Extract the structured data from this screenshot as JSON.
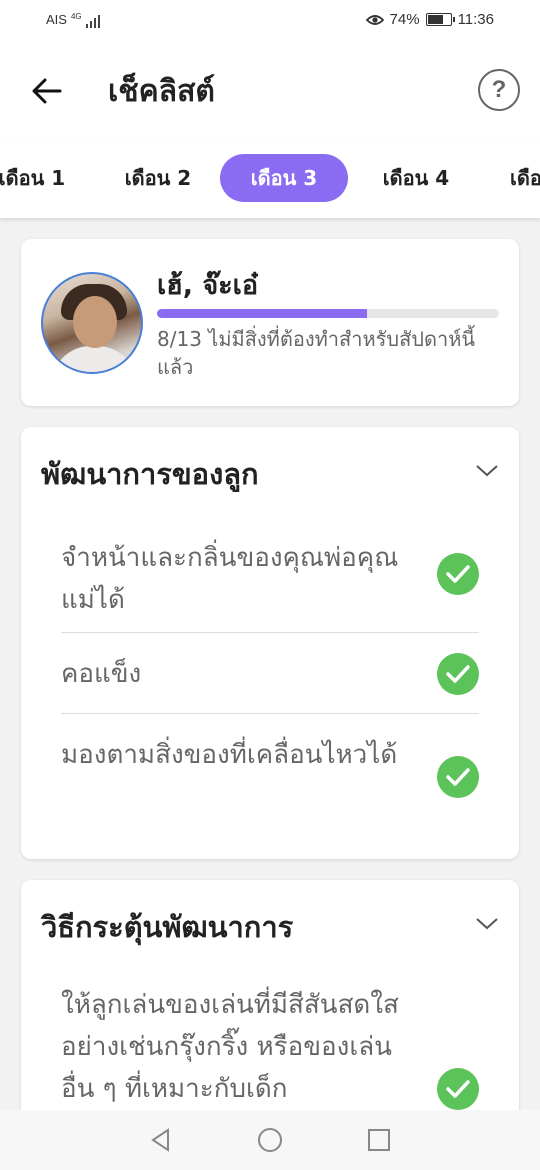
{
  "status_bar": {
    "carrier": "AIS",
    "network": "4G",
    "battery": "74%",
    "battery_level": 0.74,
    "time": "11:36"
  },
  "header": {
    "title": "เช็คลิสต์",
    "back_icon": "arrow-left-icon",
    "help_icon": "question-circle-icon",
    "help_glyph": "?"
  },
  "tabs": [
    {
      "label": "เดือน 1",
      "active": false
    },
    {
      "label": "เดือน 2",
      "active": false
    },
    {
      "label": "เดือน 3",
      "active": true
    },
    {
      "label": "เดือน 4",
      "active": false
    },
    {
      "label": "เดือ",
      "active": false
    }
  ],
  "profile": {
    "name": "เฮ้, จ๊ะเอ๋",
    "progress_fraction": 0.615,
    "progress_text": "8/13 ไม่มีสิ่งที่ต้องทำสำหรับสัปดาห์นี้แล้ว"
  },
  "sections": [
    {
      "title": "พัฒนาการของลูก",
      "items": [
        {
          "text": "จำหน้าและกลิ่นของคุณพ่อคุณแม่ได้",
          "checked": true
        },
        {
          "text": "คอแข็ง",
          "checked": true
        },
        {
          "text": "มองตามสิ่งของที่เคลื่อนไหวได้",
          "checked": true
        }
      ]
    },
    {
      "title": "วิธีกระตุ้นพัฒนาการ",
      "items": [
        {
          "text": "ให้ลูกเล่นของเล่นที่มีสีสันสดใสอย่างเช่นกรุ๊งกริ๊ง หรือของเล่นอื่น ๆ ที่เหมาะกับเด็ก",
          "checked": true
        }
      ]
    }
  ],
  "colors": {
    "accent": "#8a6cf2",
    "check": "#5cc25a",
    "avatar_border": "#4a7fd6"
  },
  "nav": {
    "back_icon": "triangle-back-icon",
    "home_icon": "circle-home-icon",
    "recents_icon": "square-recents-icon"
  }
}
